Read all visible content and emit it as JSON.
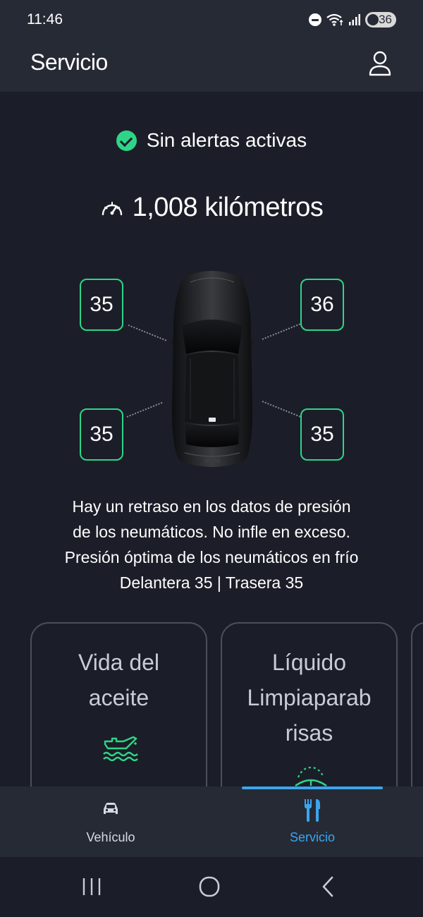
{
  "status_bar": {
    "time": "11:46",
    "battery": "36"
  },
  "header": {
    "title": "Servicio"
  },
  "alerts": {
    "text": "Sin alertas activas"
  },
  "odometer": {
    "text": "1,008 kilómetros"
  },
  "tires": {
    "front_left": "35",
    "front_right": "36",
    "rear_left": "35",
    "rear_right": "35"
  },
  "info": {
    "line1": "Hay un retraso en los datos de presión",
    "line2": "de los neumáticos. No infle en exceso.",
    "line3": "Presión óptima de los neumáticos en frío",
    "line4": "Delantera 35 | Trasera 35"
  },
  "cards": [
    {
      "title_line1": "Vida del",
      "title_line2": "aceite",
      "icon": "oil-can-icon"
    },
    {
      "title_line1": "Líquido",
      "title_line2": "Limpiaparab",
      "title_line3": "risas",
      "icon": "washer-fluid-icon"
    }
  ],
  "bottom_nav": {
    "items": [
      {
        "label": "Vehículo",
        "icon": "car-icon",
        "active": false
      },
      {
        "label": "Servicio",
        "icon": "tools-icon",
        "active": true
      }
    ]
  },
  "colors": {
    "accent_green": "#2fd587",
    "accent_blue": "#3ba5ef",
    "background": "#1b1e28",
    "header_bg": "#262a35"
  }
}
